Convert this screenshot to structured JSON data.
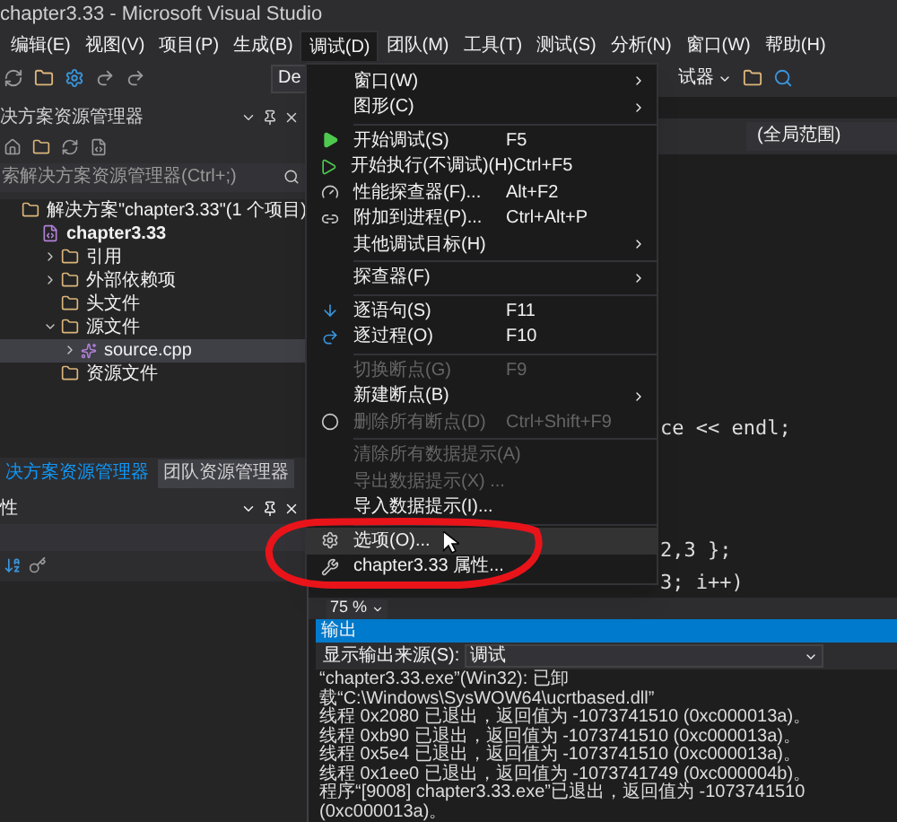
{
  "window": {
    "title": "chapter3.33 - Microsoft Visual Studio"
  },
  "menu_bar": [
    {
      "label": "编辑(E)",
      "selected": false
    },
    {
      "label": "视图(V)",
      "selected": false
    },
    {
      "label": "项目(P)",
      "selected": false
    },
    {
      "label": "生成(B)",
      "selected": false
    },
    {
      "label": "调试(D)",
      "selected": true
    },
    {
      "label": "团队(M)",
      "selected": false
    },
    {
      "label": "工具(T)",
      "selected": false
    },
    {
      "label": "测试(S)",
      "selected": false
    },
    {
      "label": "分析(N)",
      "selected": false
    },
    {
      "label": "窗口(W)",
      "selected": false
    },
    {
      "label": "帮助(H)",
      "selected": false
    }
  ],
  "toolbar": {
    "config_combo": "De",
    "debugger_combo": "试器"
  },
  "solution_explorer": {
    "title": "决方案资源管理器",
    "search": {
      "placeholder": "索解决方案资源管理器(Ctrl+;)"
    },
    "tree": [
      {
        "label": "解决方案\"chapter3.33\"(1 个项目)",
        "selected": false,
        "children": [
          {
            "label": "chapter3.33",
            "selected": false,
            "children": [
              {
                "label": "引用",
                "selected": false,
                "expanded": false
              },
              {
                "label": "外部依赖项",
                "selected": false,
                "expanded": false
              },
              {
                "label": "头文件",
                "selected": false
              },
              {
                "label": "源文件",
                "selected": false,
                "expanded": true,
                "children": [
                  {
                    "label": "source.cpp",
                    "selected": true,
                    "expanded": false
                  }
                ]
              },
              {
                "label": "资源文件",
                "selected": false
              }
            ]
          }
        ]
      }
    ],
    "tabs": [
      {
        "label": "决方案资源管理器",
        "selected": true
      },
      {
        "label": "团队资源管理器",
        "selected": false
      }
    ]
  },
  "properties": {
    "title": "性"
  },
  "editor": {
    "scope": "(全局范围)",
    "code_lines": [
      "ce << endl;",
      "2,3 };",
      "3; i++)"
    ],
    "zoom": "75 %"
  },
  "debug_menu": [
    {
      "kind": "item",
      "label": "窗口(W)",
      "submenu": true,
      "disabled": false,
      "selected": false
    },
    {
      "kind": "item",
      "label": "图形(C)",
      "submenu": true,
      "disabled": false,
      "selected": false
    },
    {
      "kind": "separator"
    },
    {
      "kind": "item",
      "label": "开始调试(S)",
      "shortcut": "F5",
      "disabled": false,
      "selected": false
    },
    {
      "kind": "item",
      "label": "开始执行(不调试)(H)",
      "shortcut": "Ctrl+F5",
      "disabled": false,
      "selected": false
    },
    {
      "kind": "item",
      "label": "性能探查器(F)...",
      "shortcut": "Alt+F2",
      "disabled": false,
      "selected": false
    },
    {
      "kind": "item",
      "label": "附加到进程(P)...",
      "shortcut": "Ctrl+Alt+P",
      "disabled": false,
      "selected": false
    },
    {
      "kind": "item",
      "label": "其他调试目标(H)",
      "submenu": true,
      "disabled": false,
      "selected": false
    },
    {
      "kind": "separator"
    },
    {
      "kind": "item",
      "label": "探查器(F)",
      "submenu": true,
      "disabled": false,
      "selected": false
    },
    {
      "kind": "separator"
    },
    {
      "kind": "item",
      "label": "逐语句(S)",
      "shortcut": "F11",
      "disabled": false,
      "selected": false
    },
    {
      "kind": "item",
      "label": "逐过程(O)",
      "shortcut": "F10",
      "disabled": false,
      "selected": false
    },
    {
      "kind": "separator"
    },
    {
      "kind": "item",
      "label": "切换断点(G)",
      "shortcut": "F9",
      "disabled": true,
      "selected": false
    },
    {
      "kind": "item",
      "label": "新建断点(B)",
      "submenu": true,
      "disabled": false,
      "selected": false
    },
    {
      "kind": "item",
      "label": "删除所有断点(D)",
      "shortcut": "Ctrl+Shift+F9",
      "disabled": true,
      "selected": false
    },
    {
      "kind": "separator"
    },
    {
      "kind": "item",
      "label": "清除所有数据提示(A)",
      "disabled": true,
      "selected": false
    },
    {
      "kind": "item",
      "label": "导出数据提示(X) ...",
      "disabled": true,
      "selected": false
    },
    {
      "kind": "item",
      "label": "导入数据提示(I)...",
      "disabled": false,
      "selected": false
    },
    {
      "kind": "separator"
    },
    {
      "kind": "item",
      "label": "选项(O)...",
      "disabled": false,
      "selected": true
    },
    {
      "kind": "item",
      "label": "chapter3.33 属性...",
      "disabled": false,
      "selected": false
    }
  ],
  "output": {
    "title": "输出",
    "source_label": "显示输出来源(S):",
    "source_value": "调试",
    "lines": [
      "“chapter3.33.exe”(Win32): 已卸载“C:\\Windows\\SysWOW64\\ucrtbased.dll”",
      "线程 0x2080 已退出，返回值为 -1073741510 (0xc000013a)。",
      "线程 0xb90 已退出，返回值为 -1073741510 (0xc000013a)。",
      "线程 0x5e4 已退出，返回值为 -1073741510 (0xc000013a)。",
      "线程 0x1ee0 已退出，返回值为 -1073741749 (0xc000004b)。",
      "程序“[9008] chapter3.33.exe”已退出，返回值为 -1073741510 (0xc000013a)。"
    ]
  }
}
